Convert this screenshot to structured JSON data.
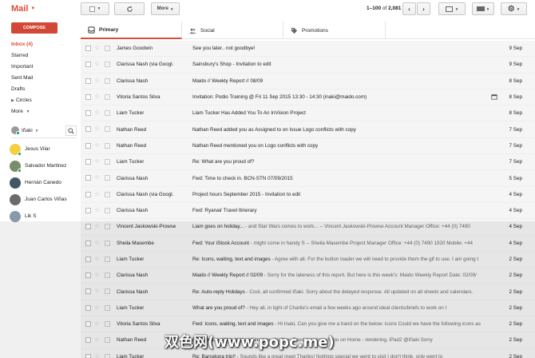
{
  "app": {
    "title": "Mail"
  },
  "toolbar": {
    "more_label": "More",
    "count_range": "1–100",
    "count_of": "of",
    "count_total": "2,081"
  },
  "nav": {
    "compose": "COMPOSE",
    "items": [
      {
        "label": "Inbox (4)",
        "active": true
      },
      {
        "label": "Starred"
      },
      {
        "label": "Important"
      },
      {
        "label": "Sent Mail"
      },
      {
        "label": "Drafts"
      },
      {
        "label": "Circles",
        "expand": true
      },
      {
        "label": "More"
      }
    ]
  },
  "hangouts": {
    "me": "Iñaki",
    "contacts": [
      {
        "name": "Jesus Vilar",
        "color": "#f4d03f",
        "online": true
      },
      {
        "name": "Salvador Martinez",
        "color": "#7a8d6a",
        "online": true
      },
      {
        "name": "Hernán Canedo",
        "color": "#445566",
        "online": false
      },
      {
        "name": "Juan Carlos Viñas",
        "color": "#6b6b6b",
        "online": false
      },
      {
        "name": "Lik S",
        "color": "#8899aa",
        "online": false
      }
    ]
  },
  "tabs": [
    {
      "label": "Primary",
      "icon": "inbox-icon"
    },
    {
      "label": "Social",
      "icon": "people-icon"
    },
    {
      "label": "Promotions",
      "icon": "tag-icon"
    }
  ],
  "messages": [
    {
      "from": "James Goodwin",
      "subject": "See you later.. not goodbye!",
      "snippet": "",
      "date": "9 Sep"
    },
    {
      "from": "Clarissa Nash (via Googl.",
      "subject": "Sainsbury's Shop - Invitation to edit",
      "snippet": "",
      "date": "9 Sep"
    },
    {
      "from": "Clarissa Nash",
      "subject": "Maido // Weekly Report // 08/09",
      "snippet": "",
      "date": "8 Sep"
    },
    {
      "from": "Vitoria Santos Silva",
      "subject": "Invitation: Podio Training @ Fri 11 Sep 2015 13:30 - 14:30 (inaki@maido.com)",
      "snippet": "",
      "date": "8 Sep",
      "attachment": true
    },
    {
      "from": "Liam Tucker",
      "subject": "Liam Tucker Has Added You To An InVision Project",
      "snippet": "",
      "date": "8 Sep"
    },
    {
      "from": "Nathan Reed",
      "subject": "Nathan Reed added you as Assigned to on Issue Logo conflicts with copy",
      "snippet": "",
      "date": "7 Sep"
    },
    {
      "from": "Nathan Reed",
      "subject": "Nathan Reed mentioned you on Logo conflicts with copy",
      "snippet": "",
      "date": "7 Sep"
    },
    {
      "from": "Liam Tucker",
      "subject": "Re: What are you proud of?",
      "snippet": "",
      "date": "7 Sep"
    },
    {
      "from": "Clarissa Nash",
      "subject": "Fwd: Time to check in. BCN-STN 07/09/2015",
      "snippet": "",
      "date": "5 Sep"
    },
    {
      "from": "Clarissa Nash (via Googl.",
      "subject": "Project hours September 2015 - Invitation to edit",
      "snippet": "",
      "date": "4 Sep"
    },
    {
      "from": "Clarissa Nash",
      "subject": "Fwd: Ryanair Travel Itinerary",
      "snippet": "",
      "date": "4 Sep"
    },
    {
      "from": "Vincent Jaskowski-Prowse",
      "subject": "Liam goes on holiday...",
      "snippet": " - and Star Wars comes to work... -- Vincent Jaskowski-Prowse Account Manager Office: +44 (0) 7490",
      "date": "4 Sep"
    },
    {
      "from": "Sheila Masembe",
      "subject": "Fwd: Your iStock Account",
      "snippet": " - might come in handy S -- Sheila Masembe Project Manager Office: +44 (0) 7490 1920 Mobile: +44",
      "date": "4 Sep"
    },
    {
      "from": "Liam Tucker",
      "subject": "Re: Icons, waiting, text and images",
      "snippet": " - Agree with all. For the button loader we will need to provide them the gif to use. I am going t",
      "date": "2 Sep"
    },
    {
      "from": "Clarissa Nash",
      "subject": "Maido // Weekly Report // 02/09",
      "snippet": " - Sorry for the lateness of this report. But here is this week's: Maido Weekly Report Date: 02/09/",
      "date": "2 Sep"
    },
    {
      "from": "Clarissa Nash",
      "subject": "Re: Auto-reply Holidays",
      "snippet": " - Cool, all confirmed Iñaki. Sorry about the delayed response. All updated on all sheets and calendars.",
      "date": "2 Sep"
    },
    {
      "from": "Liam Tucker",
      "subject": "What are you proud of?",
      "snippet": " - Hey all, in light of Charlie's email a few weeks ago around ideal clients/briefs to work on I",
      "date": "2 Sep"
    },
    {
      "from": "Vitoria Santos Silva",
      "subject": "Fwd: Icons, waiting, text and images",
      "snippet": " - Hi Inaki, Can you give me a hand on the below: Icons Could we have the following icons as",
      "date": "2 Sep"
    },
    {
      "from": "Nathan Reed",
      "subject": "Re: Icons, waiting, text and images",
      "snippet": " - Nathan Reed mentioned you on Home - rendering, iPad2 @Iñaki Sorry",
      "date": "2 Sep"
    },
    {
      "from": "Liam Tucker",
      "subject": "Re: Barcelona trip!!",
      "snippet": " - Sounds like a great meet Thanks! Nothing special we went to visit I don't think, only went to",
      "date": "2 Sep"
    }
  ],
  "watermark": "双色网(www.popc.me)"
}
